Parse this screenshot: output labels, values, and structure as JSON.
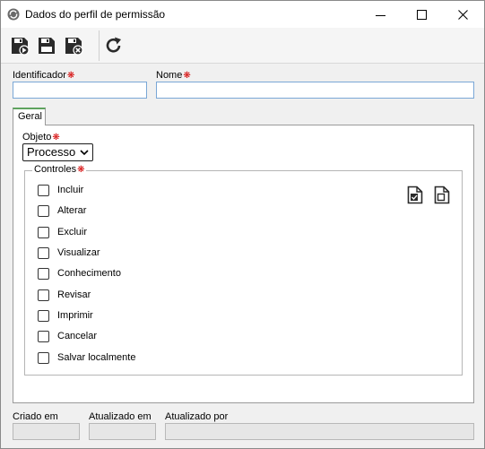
{
  "window": {
    "title": "Dados do perfil de permissão"
  },
  "toolbar": {
    "buttons": [
      {
        "name": "save-new-icon"
      },
      {
        "name": "save-icon"
      },
      {
        "name": "save-close-icon"
      },
      {
        "name": "refresh-icon"
      }
    ]
  },
  "form": {
    "identificador_label": "Identificador",
    "identificador_value": "",
    "nome_label": "Nome",
    "nome_value": "",
    "required_mark": "❋"
  },
  "tabs": [
    {
      "label": "Geral",
      "active": true
    }
  ],
  "geral": {
    "objeto_label": "Objeto",
    "objeto_value": "Processo",
    "controles_label": "Controles",
    "controles": [
      {
        "label": "Incluir",
        "checked": false
      },
      {
        "label": "Alterar",
        "checked": false
      },
      {
        "label": "Excluir",
        "checked": false
      },
      {
        "label": "Visualizar",
        "checked": false
      },
      {
        "label": "Conhecimento",
        "checked": false
      },
      {
        "label": "Revisar",
        "checked": false
      },
      {
        "label": "Imprimir",
        "checked": false
      },
      {
        "label": "Cancelar",
        "checked": false
      },
      {
        "label": "Salvar localmente",
        "checked": false
      }
    ]
  },
  "footer": {
    "criado_em_label": "Criado em",
    "criado_em_value": "",
    "atualizado_em_label": "Atualizado em",
    "atualizado_em_value": "",
    "atualizado_por_label": "Atualizado por",
    "atualizado_por_value": ""
  },
  "colors": {
    "required": "#d40000",
    "input_border": "#7aa7d6",
    "tab_accent": "#5fa35f"
  }
}
